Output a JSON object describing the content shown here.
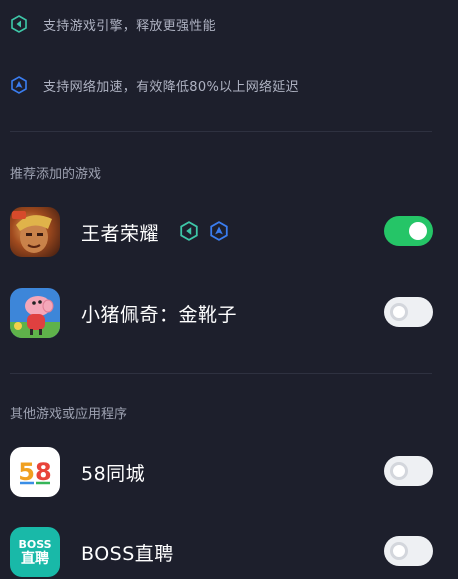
{
  "features": [
    {
      "icon": "game-engine-icon",
      "text": "支持游戏引擎，释放更强性能"
    },
    {
      "icon": "network-accel-icon",
      "text": "支持网络加速，有效降低80%以上网络延迟"
    }
  ],
  "recommended": {
    "title": "推荐添加的游戏",
    "apps": [
      {
        "name": "王者荣耀",
        "enabled": true,
        "badges": [
          "game-engine-icon",
          "network-accel-icon"
        ]
      },
      {
        "name": "小猪佩奇：金靴子",
        "enabled": false,
        "badges": []
      }
    ]
  },
  "others": {
    "title": "其他游戏或应用程序",
    "apps": [
      {
        "name": "58同城",
        "icon_text": "58",
        "enabled": false
      },
      {
        "name": "BOSS直聘",
        "icon_text_top": "BOSS",
        "icon_text_bottom": "直聘",
        "enabled": false
      }
    ]
  },
  "colors": {
    "background": "#1d1f2c",
    "toggle_on": "#25c567",
    "toggle_off": "#eef0f3",
    "engine_badge": "#3ec7a8",
    "network_badge": "#3a7df0"
  }
}
